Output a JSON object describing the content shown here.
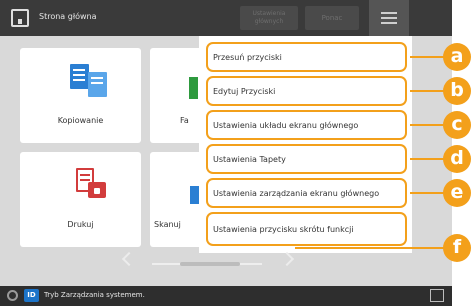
{
  "topbar": {
    "title": "Strona główna",
    "settings_button": "Ustawienia głównych",
    "close_button": "Ponac"
  },
  "tiles": [
    {
      "label": "Kopiowanie",
      "icon": "copy-icon"
    },
    {
      "label": "Fa",
      "icon": "fax-icon"
    },
    {
      "label": "Drukuj",
      "icon": "print-icon"
    },
    {
      "label": "Skanuj",
      "icon": "scan-icon"
    }
  ],
  "menu": {
    "items": [
      {
        "label": "Przesuń przyciski"
      },
      {
        "label": "Edytuj Przyciski"
      },
      {
        "label": "Ustawienia układu ekranu głównego"
      },
      {
        "label": "Ustawienia Tapety"
      },
      {
        "label": "Ustawienia zarządzania ekranu głównego"
      },
      {
        "label": "Ustawienia przycisku skrótu funkcji"
      }
    ]
  },
  "status": {
    "id_icon_text": "ID",
    "text": "Tryb Zarządzania systemem."
  },
  "callouts": [
    "a",
    "b",
    "c",
    "d",
    "e",
    "f"
  ],
  "colors": {
    "accent": "#f3a01b",
    "topbar": "#3a3a3a",
    "background": "#d9d9d9",
    "copy_blue": "#2b7fd3",
    "print_red": "#d23c3c",
    "fax_green": "#2e9a3e"
  }
}
